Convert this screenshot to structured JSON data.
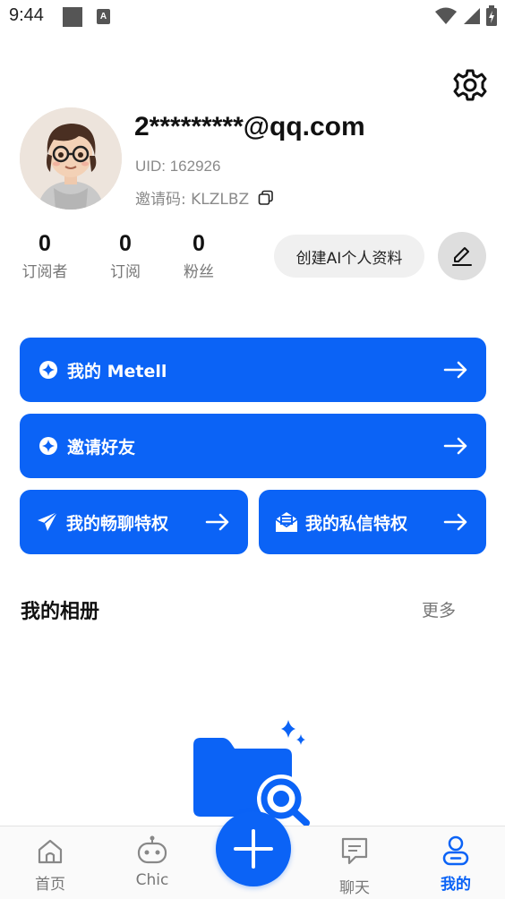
{
  "status_bar": {
    "time": "9:44",
    "badge_letter": "A"
  },
  "profile": {
    "email": "2*********@qq.com",
    "uid_label": "UID: 162926",
    "invite_label": "邀请码: KLZLBZ"
  },
  "stats": [
    {
      "value": "0",
      "label": "订阅者"
    },
    {
      "value": "0",
      "label": "订阅"
    },
    {
      "value": "0",
      "label": "粉丝"
    }
  ],
  "actions": {
    "create_ai_label": "创建AI个人资料"
  },
  "cards": {
    "metell": "我的 Metell",
    "invite": "邀请好友",
    "chat_privilege": "我的畅聊特权",
    "dm_privilege": "我的私信特权"
  },
  "album": {
    "title": "我的相册",
    "more": "更多"
  },
  "tabbar": {
    "home": "首页",
    "chic": "Chic",
    "chat": "聊天",
    "mine": "我的"
  },
  "colors": {
    "accent": "#0b63f6",
    "muted_text": "#8a8a8a"
  }
}
